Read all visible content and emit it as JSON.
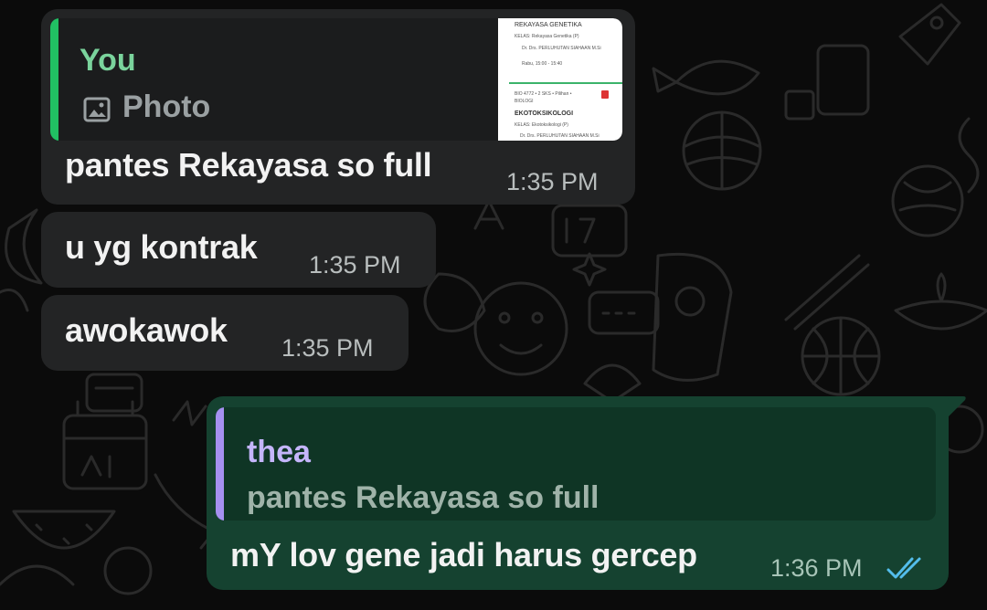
{
  "colors": {
    "background": "#0b0b0b",
    "incoming_bubble": "#232425",
    "outgoing_bubble": "#154230",
    "reply_you_accent": "#21c063",
    "reply_you_name": "#7ad39c",
    "reply_thea_accent": "#a590f0",
    "reply_thea_name": "#c4b5fb",
    "read_ticks": "#53bdeb"
  },
  "messages": [
    {
      "id": "m1",
      "direction": "incoming",
      "reply": {
        "name": "You",
        "icon": "photo-icon",
        "text": "Photo"
      },
      "thumbnail": {
        "header": "REKAYASA GENETIKA",
        "kelas1": "KELAS: Rekayasa Genetika (P)",
        "dosen1": "Dr. Drs. PERLUHUTAN SIAHAAN M.Si",
        "time1": "Rabu, 15:00 - 15:40",
        "code": "BIO 4772 • 2 SKS • Pilihan • BIOLOGI",
        "course": "EKOTOKSIKOLOGI",
        "kelas2": "KELAS: Ekotoksikologi (P)",
        "dosen2": "Dr. Drs. PERLUHUTAN SIAHAAN M.Si"
      },
      "text": "pantes Rekayasa so full",
      "time": "1:35 PM"
    },
    {
      "id": "m2",
      "direction": "incoming",
      "text": "u yg kontrak",
      "time": "1:35 PM"
    },
    {
      "id": "m3",
      "direction": "incoming",
      "text": "awokawok",
      "time": "1:35 PM"
    },
    {
      "id": "m4",
      "direction": "outgoing",
      "reply": {
        "name": "thea",
        "text": "pantes Rekayasa so full"
      },
      "text": "mY lov gene jadi harus gercep",
      "time": "1:36 PM",
      "status": "read"
    }
  ]
}
